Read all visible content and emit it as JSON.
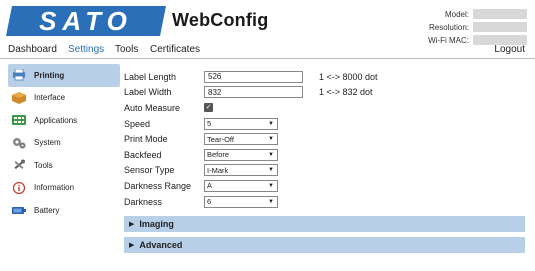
{
  "header": {
    "logo_text": "SATO",
    "title": "WebConfig",
    "brand_color": "#2a6fb8",
    "device_info": [
      {
        "label": "Model:"
      },
      {
        "label": "Resolution:"
      },
      {
        "label": "Wi-Fi MAC:"
      }
    ]
  },
  "nav": {
    "items": [
      "Dashboard",
      "Settings",
      "Tools",
      "Certificates"
    ],
    "active": "Settings",
    "logout": "Logout"
  },
  "sidebar": {
    "items": [
      {
        "label": "Printing",
        "icon": "printer-icon",
        "active": true
      },
      {
        "label": "Interface",
        "icon": "interface-icon",
        "active": false
      },
      {
        "label": "Applications",
        "icon": "applications-icon",
        "active": false
      },
      {
        "label": "System",
        "icon": "gear-icon",
        "active": false
      },
      {
        "label": "Tools",
        "icon": "tools-icon",
        "active": false
      },
      {
        "label": "Information",
        "icon": "info-icon",
        "active": false
      },
      {
        "label": "Battery",
        "icon": "battery-icon",
        "active": false
      }
    ]
  },
  "form": {
    "label_length": {
      "label": "Label Length",
      "value": "526",
      "range": "1 <-> 8000 dot"
    },
    "label_width": {
      "label": "Label Width",
      "value": "832",
      "range": "1 <-> 832 dot"
    },
    "auto_measure": {
      "label": "Auto Measure",
      "checked": true
    },
    "speed": {
      "label": "Speed",
      "value": "5"
    },
    "print_mode": {
      "label": "Print Mode",
      "value": "Tear-Off"
    },
    "backfeed": {
      "label": "Backfeed",
      "value": "Before"
    },
    "sensor_type": {
      "label": "Sensor Type",
      "value": "I-Mark"
    },
    "darkness_range": {
      "label": "Darkness Range",
      "value": "A"
    },
    "darkness": {
      "label": "Darkness",
      "value": "6"
    }
  },
  "sections": {
    "imaging": "Imaging",
    "advanced": "Advanced"
  },
  "colors": {
    "accent_bg": "#b8cfe8",
    "active_nav": "#2a6fb8"
  }
}
